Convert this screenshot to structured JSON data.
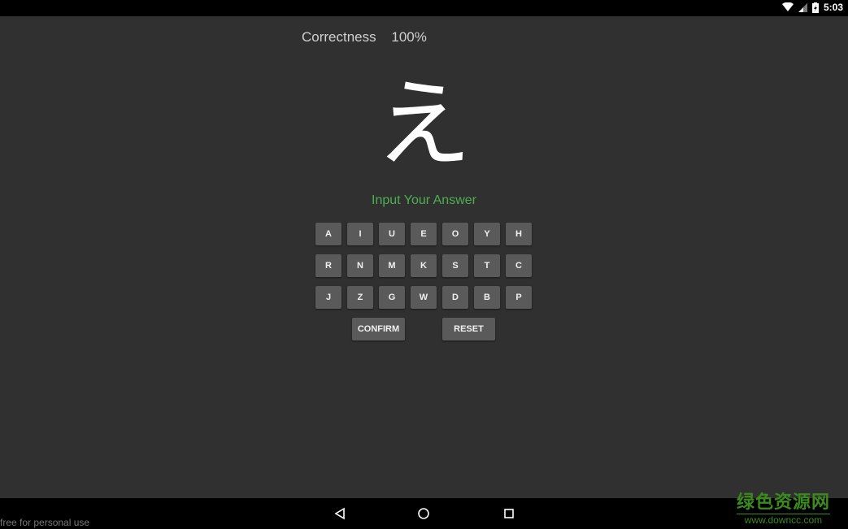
{
  "status_bar": {
    "time": "5:03",
    "icons": [
      "wifi-icon",
      "signal-icon",
      "battery-charging-icon"
    ]
  },
  "score": {
    "label": "Correctness",
    "value": "100%"
  },
  "question": {
    "character": "え"
  },
  "prompt": "Input Your Answer",
  "keys": [
    [
      "A",
      "I",
      "U",
      "E",
      "O",
      "Y",
      "H"
    ],
    [
      "R",
      "N",
      "M",
      "K",
      "S",
      "T",
      "C"
    ],
    [
      "J",
      "Z",
      "G",
      "W",
      "D",
      "B",
      "P"
    ]
  ],
  "actions": {
    "confirm": "CONFIRM",
    "reset": "RESET"
  },
  "footer": {
    "free_text": "free for personal use",
    "watermark_cn": "绿色资源网",
    "watermark_en": "www.downcc.com"
  },
  "colors": {
    "background": "#303030",
    "accent": "#4caf50",
    "key": "#5a5a5a"
  }
}
